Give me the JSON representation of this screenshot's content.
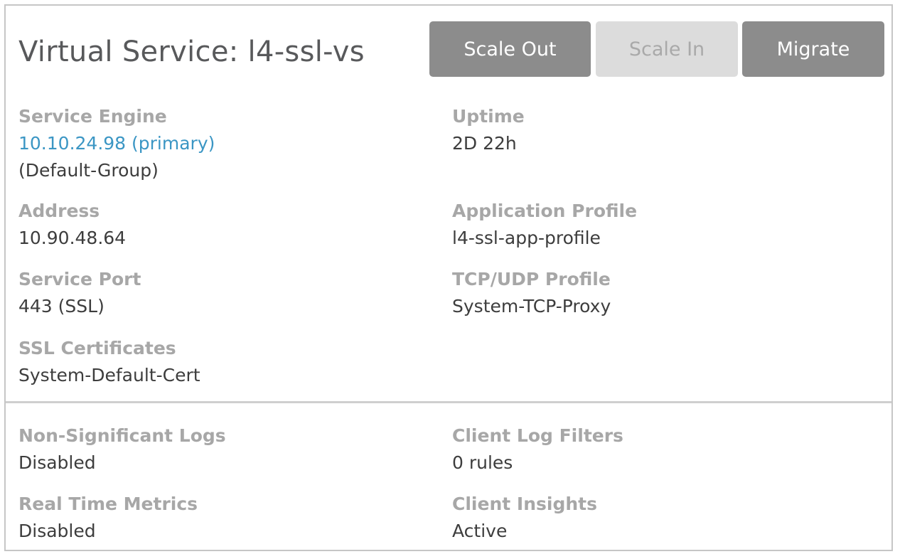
{
  "header": {
    "title": "Virtual Service: l4-ssl-vs",
    "buttons": {
      "scale_out": "Scale Out",
      "scale_in": "Scale In",
      "migrate": "Migrate"
    }
  },
  "details": {
    "service_engine": {
      "label": "Service Engine",
      "value_link": "10.10.24.98 (primary)",
      "group": "(Default-Group)"
    },
    "uptime": {
      "label": "Uptime",
      "value": "2D 22h"
    },
    "address": {
      "label": "Address",
      "value": "10.90.48.64"
    },
    "application_profile": {
      "label": "Application Profile",
      "value": "l4-ssl-app-profile"
    },
    "service_port": {
      "label": "Service Port",
      "value": "443 (SSL)"
    },
    "tcp_udp_profile": {
      "label": "TCP/UDP Profile",
      "value": "System-TCP-Proxy"
    },
    "ssl_certificates": {
      "label": "SSL Certificates",
      "value": "System-Default-Cert"
    }
  },
  "logging": {
    "non_significant_logs": {
      "label": "Non-Significant Logs",
      "value": "Disabled"
    },
    "client_log_filters": {
      "label": "Client Log Filters",
      "value": "0 rules"
    },
    "real_time_metrics": {
      "label": "Real Time Metrics",
      "value": "Disabled"
    },
    "client_insights": {
      "label": "Client Insights",
      "value": "Active"
    }
  },
  "colors": {
    "link": "#3b96c4",
    "button_active": "#8c8c8c",
    "button_disabled": "#dcdcdc",
    "label": "#a7a7a7"
  }
}
